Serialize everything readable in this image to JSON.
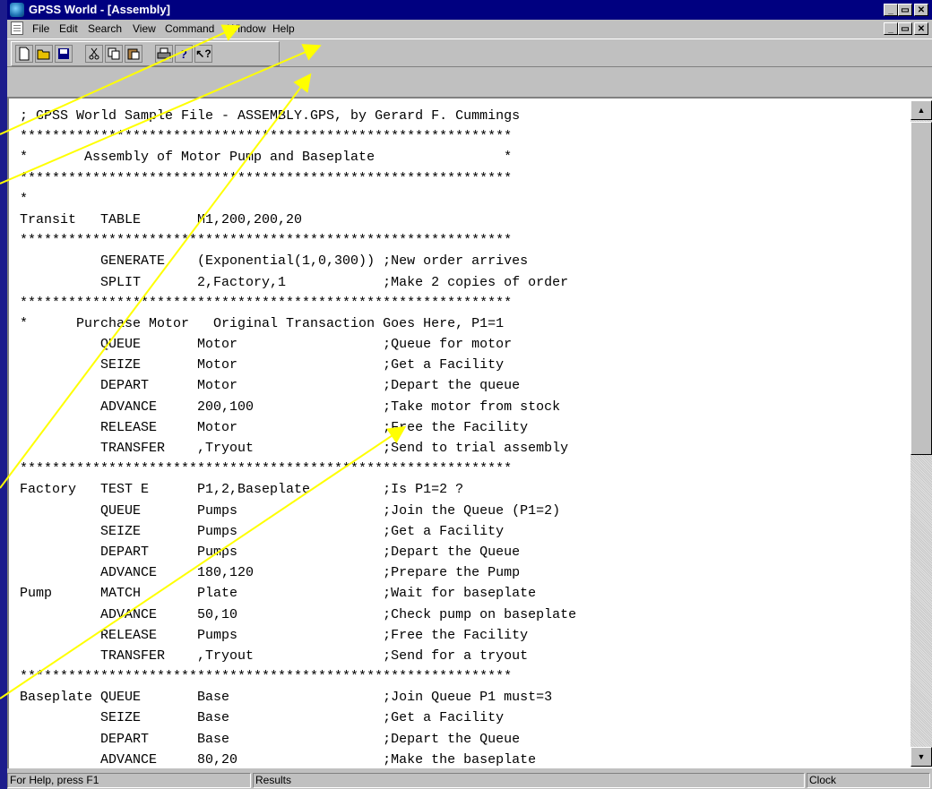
{
  "window": {
    "title": "GPSS World - [Assembly]",
    "titlebar_color": "#000080",
    "controls": [
      "minimize-icon",
      "maximize-icon",
      "close-icon"
    ]
  },
  "menubar": {
    "items": [
      {
        "label": "File"
      },
      {
        "label": "Edit"
      },
      {
        "label": "Search"
      },
      {
        "label": "View"
      },
      {
        "label": "Command"
      },
      {
        "label": "Window"
      },
      {
        "label": "Help"
      }
    ]
  },
  "toolbar": {
    "buttons": [
      "new-icon",
      "open-icon",
      "save-icon",
      "cut-icon",
      "copy-icon",
      "paste-icon",
      "print-icon",
      "help-icon",
      "context-help-icon"
    ]
  },
  "editor": {
    "lines": [
      "; GPSS World Sample File - ASSEMBLY.GPS, by Gerard F. Cummings",
      "*************************************************************",
      "*       Assembly of Motor Pump and Baseplate                *",
      "*************************************************************",
      "*",
      "Transit   TABLE       M1,200,200,20",
      "*************************************************************",
      "          GENERATE    (Exponential(1,0,300)) ;New order arrives",
      "          SPLIT       2,Factory,1            ;Make 2 copies of order",
      "*************************************************************",
      "*      Purchase Motor   Original Transaction Goes Here, P1=1",
      "          QUEUE       Motor                  ;Queue for motor",
      "          SEIZE       Motor                  ;Get a Facility",
      "          DEPART      Motor                  ;Depart the queue",
      "          ADVANCE     200,100                ;Take motor from stock",
      "          RELEASE     Motor                  ;Free the Facility",
      "          TRANSFER    ,Tryout                ;Send to trial assembly",
      "*************************************************************",
      "Factory   TEST E      P1,2,Baseplate         ;Is P1=2 ?",
      "          QUEUE       Pumps                  ;Join the Queue (P1=2)",
      "          SEIZE       Pumps                  ;Get a Facility",
      "          DEPART      Pumps                  ;Depart the Queue",
      "          ADVANCE     180,120                ;Prepare the Pump",
      "Pump      MATCH       Plate                  ;Wait for baseplate",
      "          ADVANCE     50,10                  ;Check pump on baseplate",
      "          RELEASE     Pumps                  ;Free the Facility",
      "          TRANSFER    ,Tryout                ;Send for a tryout",
      "*************************************************************",
      "Baseplate QUEUE       Base                   ;Join Queue P1 must=3",
      "          SEIZE       Base                   ;Get a Facility",
      "          DEPART      Base                   ;Depart the Queue",
      "          ADVANCE     80,20                  ;Make the baseplate"
    ]
  },
  "statusbar": {
    "help": "For Help, press F1",
    "results": "Results",
    "clock": "Clock"
  },
  "annotation_color": "#ffff00"
}
